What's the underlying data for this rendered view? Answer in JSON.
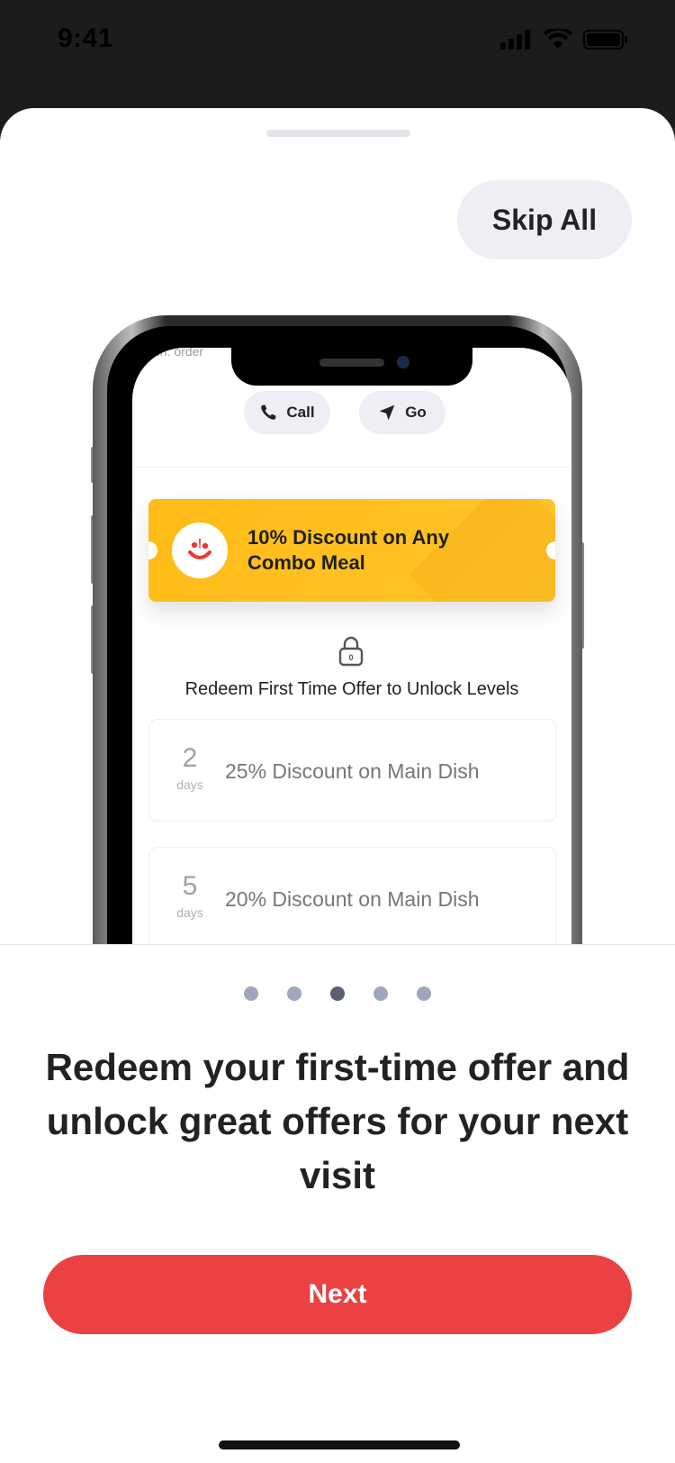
{
  "status_bar": {
    "time": "9:41",
    "icons": [
      "cellular-signal-icon",
      "wifi-icon",
      "battery-icon"
    ]
  },
  "header": {
    "skip_label": "Skip All"
  },
  "preview": {
    "top_faded_text": "Min. order",
    "call_label": "Call",
    "go_label": "Go",
    "coupon": {
      "title": "10% Discount on Any Combo Meal",
      "logo_icon": "smiley-logo-icon",
      "accent": "#FFC226"
    },
    "lock_hint": "Redeem First Time Offer to Unlock Levels",
    "lock_digit": "0",
    "levels": [
      {
        "days_number": "2",
        "days_unit": "days",
        "offer": "25% Discount on Main Dish"
      },
      {
        "days_number": "5",
        "days_unit": "days",
        "offer": "20% Discount on Main Dish"
      }
    ]
  },
  "onboarding": {
    "pages_total": 5,
    "current_page": 3,
    "headline": "Redeem your first-time offer and unlock great offers for your next visit",
    "next_label": "Next",
    "accent": "#EA4242"
  }
}
